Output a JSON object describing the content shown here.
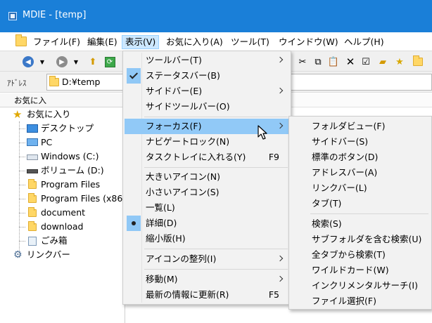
{
  "window": {
    "title": "MDIE - [temp]"
  },
  "menubar": {
    "items": [
      {
        "label": "ファイル(F)"
      },
      {
        "label": "編集(E)"
      },
      {
        "label": "表示(V)"
      },
      {
        "label": "お気に入り(A)"
      },
      {
        "label": "ツール(T)"
      },
      {
        "label": "ウインドウ(W)"
      },
      {
        "label": "ヘルプ(H)"
      }
    ]
  },
  "toolbar": {
    "icons": [
      "back-icon",
      "dropdown-icon",
      "forward-icon",
      "dropdown-icon",
      "up-folder-icon",
      "refresh-icon",
      "cut-icon",
      "copy-icon",
      "paste-icon",
      "delete-icon",
      "properties-icon",
      "new-folder-icon",
      "favorite-add-icon",
      "folder-icon"
    ]
  },
  "addressbar": {
    "label": "ｱﾄﾞﾚｽ",
    "value": "D:¥temp"
  },
  "left_pane": {
    "header": "お気に入",
    "tree": [
      {
        "label": "お気に入り",
        "icon": "star-icon"
      },
      {
        "label": "デスクトップ",
        "icon": "desktop-icon"
      },
      {
        "label": "PC",
        "icon": "pc-icon"
      },
      {
        "label": "Windows (C:)",
        "icon": "drive-icon"
      },
      {
        "label": "ボリューム (D:)",
        "icon": "drive-icon"
      },
      {
        "label": "Program Files",
        "icon": "folder-icon"
      },
      {
        "label": "Program Files (x86)",
        "icon": "folder-icon"
      },
      {
        "label": "document",
        "icon": "folder-icon"
      },
      {
        "label": "download",
        "icon": "folder-icon"
      },
      {
        "label": "ごみ箱",
        "icon": "recycle-bin-icon"
      },
      {
        "label": "リンクバー",
        "icon": "gear-icon"
      }
    ]
  },
  "view_menu": {
    "items": [
      {
        "label": "ツールバー(T)",
        "submenu": true
      },
      {
        "label": "ステータスバー(B)",
        "checked": true
      },
      {
        "label": "サイドバー(E)",
        "submenu": true
      },
      {
        "label": "サイドツールバー(O)"
      },
      {
        "label": "フォーカス(F)",
        "submenu": true,
        "highlighted": true
      },
      {
        "label": "ナビゲートロック(N)"
      },
      {
        "label": "タスクトレイに入れる(Y)",
        "shortcut": "F9"
      },
      {
        "label": "大きいアイコン(N)"
      },
      {
        "label": "小さいアイコン(S)"
      },
      {
        "label": "一覧(L)"
      },
      {
        "label": "詳細(D)",
        "selected": true
      },
      {
        "label": "縮小版(H)"
      },
      {
        "label": "アイコンの整列(I)",
        "submenu": true
      },
      {
        "label": "移動(M)",
        "submenu": true
      },
      {
        "label": "最新の情報に更新(R)",
        "shortcut": "F5"
      }
    ]
  },
  "focus_submenu": {
    "items": [
      {
        "label": "フォルダビュー(F)"
      },
      {
        "label": "サイドバー(S)"
      },
      {
        "label": "標準のボタン(D)"
      },
      {
        "label": "アドレスバー(A)"
      },
      {
        "label": "リンクバー(L)"
      },
      {
        "label": "タブ(T)"
      },
      {
        "label": "検索(S)"
      },
      {
        "label": "サブフォルダを含む検索(U)"
      },
      {
        "label": "全タブから検索(T)"
      },
      {
        "label": "ワイルドカード(W)"
      },
      {
        "label": "インクリメンタルサーチ(I)"
      },
      {
        "label": "ファイル選択(F)"
      }
    ]
  },
  "colors": {
    "titlebar": "#1a7fd8",
    "menu_highlight": "#91c9f7",
    "menubar_active": "#cce8ff"
  }
}
